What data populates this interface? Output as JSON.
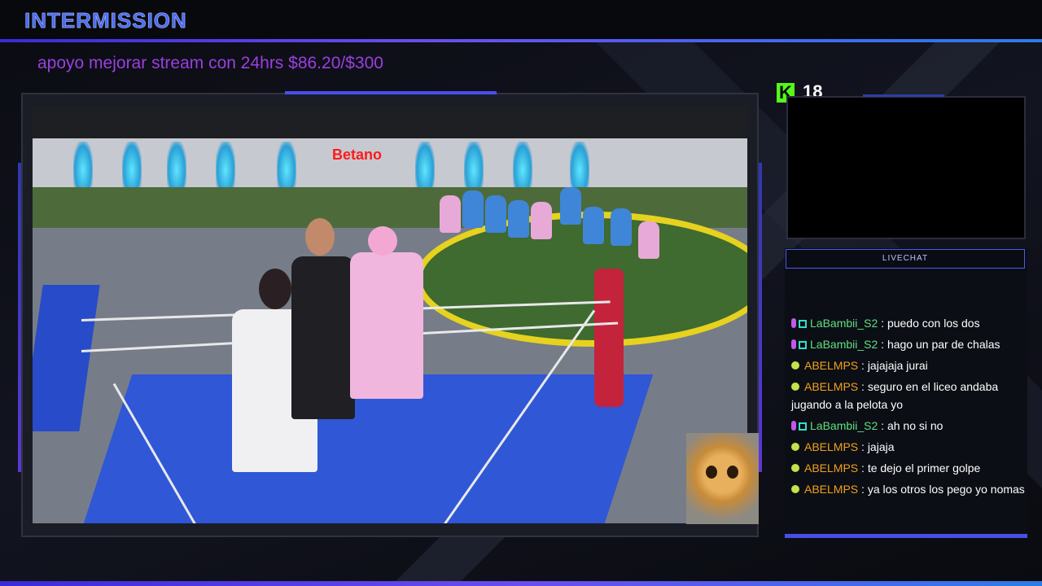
{
  "header": {
    "title": "INTERMISSION",
    "goal_text": "apoyo mejorar stream con 24hrs $86.20/$300"
  },
  "stream": {
    "viewer_icon": "K",
    "viewer_count": "18",
    "sign_text": "Betano"
  },
  "chat": {
    "title": "LIVECHAT",
    "messages": [
      {
        "user": "LaBambii_S2",
        "sep": ":",
        "text": "puedo con los dos",
        "badges": [
          "mic-badge",
          "square-badge"
        ],
        "color": "#5fe07e"
      },
      {
        "user": "LaBambii_S2",
        "sep": ":",
        "text": "hago un par de chalas",
        "badges": [
          "mic-badge",
          "square-badge"
        ],
        "color": "#5fe07e"
      },
      {
        "user": "ABELMPS",
        "sep": ":",
        "text": "jajajaja jurai",
        "badges": [
          "bolt-badge"
        ],
        "color": "#f0a21a"
      },
      {
        "user": "ABELMPS",
        "sep": ":",
        "text": "seguro en el liceo andaba jugando a la pelota yo",
        "badges": [
          "bolt-badge"
        ],
        "color": "#f0a21a"
      },
      {
        "user": "LaBambii_S2",
        "sep": ":",
        "text": "ah no si no",
        "badges": [
          "mic-badge",
          "square-badge"
        ],
        "color": "#5fe07e"
      },
      {
        "user": "ABELMPS",
        "sep": ":",
        "text": "jajaja",
        "badges": [
          "bolt-badge"
        ],
        "color": "#f0a21a"
      },
      {
        "user": "ABELMPS",
        "sep": ":",
        "text": "te dejo el primer golpe",
        "badges": [
          "bolt-badge"
        ],
        "color": "#f0a21a"
      },
      {
        "user": "ABELMPS",
        "sep": ":",
        "text": "ya los otros los pego yo nomas",
        "badges": [
          "bolt-badge"
        ],
        "color": "#f0a21a"
      }
    ]
  },
  "colors": {
    "accent": "#4a4ee8",
    "kick_green": "#53fc18",
    "goal_purple": "#9b3fe0"
  }
}
